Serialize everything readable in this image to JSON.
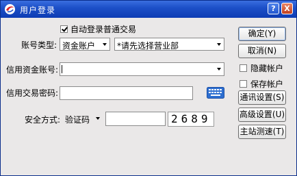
{
  "window": {
    "title": "用户登录",
    "help_label": "?",
    "close_label": "X"
  },
  "auto_login": {
    "label": "自动登录普通交易",
    "checked": true
  },
  "account_type": {
    "label": "账号类型:",
    "value": "资金账户"
  },
  "department": {
    "value": "*请先选择营业部"
  },
  "credit_account": {
    "label": "信用资金账号:",
    "value": ""
  },
  "trade_password": {
    "label": "信用交易密码:",
    "value": ""
  },
  "security": {
    "label": "安全方式:",
    "mode": "验证码",
    "input_value": "",
    "captcha": "2689"
  },
  "buttons": {
    "ok": "确定(Y)",
    "cancel": "取消(N)",
    "comm_settings": "通讯设置(S)",
    "advanced_settings": "高级设置(U)",
    "server_speed_test": "主站测速(T)"
  },
  "options": {
    "hide_account": {
      "label": "隐藏帐户",
      "checked": false
    },
    "save_account": {
      "label": "保存帐户",
      "checked": false
    }
  }
}
